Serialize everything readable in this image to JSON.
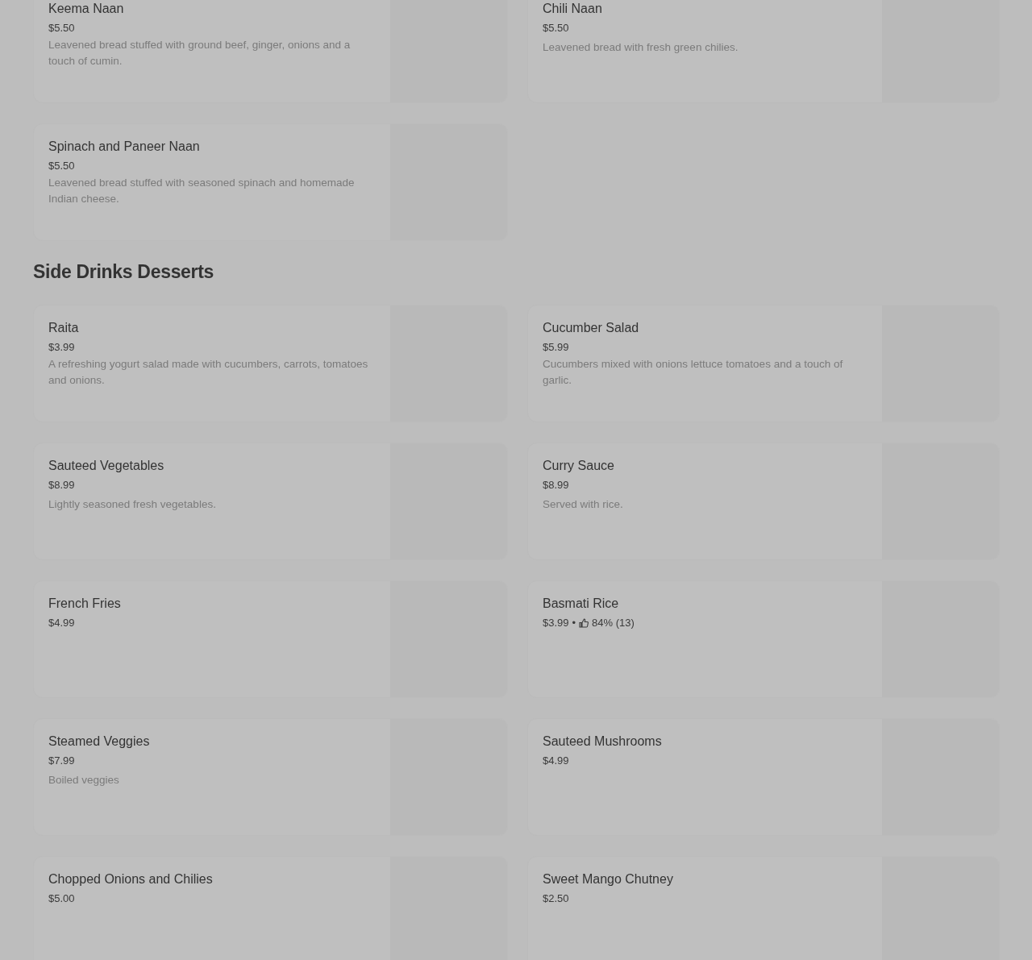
{
  "sections": [
    {
      "items": [
        {
          "name": "Keema Naan",
          "price": "$5.50",
          "description": "Leavened bread stuffed with ground beef, ginger, onions and a touch of cumin."
        },
        {
          "name": "Chili Naan",
          "price": "$5.50",
          "description": "Leavened bread with fresh green chilies."
        },
        {
          "name": "Spinach and Paneer Naan",
          "price": "$5.50",
          "description": "Leavened bread stuffed with seasoned spinach and homemade Indian cheese."
        }
      ]
    },
    {
      "title": "Side Drinks Desserts",
      "items": [
        {
          "name": "Raita",
          "price": "$3.99",
          "description": "A refreshing yogurt salad made with cucumbers, carrots, tomatoes and onions."
        },
        {
          "name": "Cucumber Salad",
          "price": "$5.99",
          "description": "Cucumbers mixed with onions lettuce tomatoes and a touch of garlic."
        },
        {
          "name": "Sauteed Vegetables",
          "price": "$8.99",
          "description": "Lightly seasoned fresh vegetables."
        },
        {
          "name": "Curry Sauce",
          "price": "$8.99",
          "description": "Served with rice."
        },
        {
          "name": "French Fries",
          "price": "$4.99"
        },
        {
          "name": "Basmati Rice",
          "price": "$3.99",
          "separator": "•",
          "rating": "84% (13)"
        },
        {
          "name": "Steamed Veggies",
          "price": "$7.99",
          "description": "Boiled veggies"
        },
        {
          "name": "Sauteed Mushrooms",
          "price": "$4.99"
        },
        {
          "name": "Chopped Onions and Chilies",
          "price": "$5.00"
        },
        {
          "name": "Sweet Mango Chutney",
          "price": "$2.50"
        }
      ]
    }
  ]
}
